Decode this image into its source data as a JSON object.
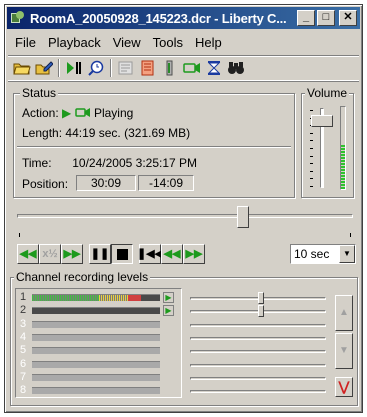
{
  "window": {
    "title": "RoomA_20050928_145223.dcr - Liberty C...",
    "minimize_label": "_",
    "maximize_label": "□",
    "close_label": "✕"
  },
  "menu": [
    "File",
    "Playback",
    "View",
    "Tools",
    "Help"
  ],
  "toolbar": {
    "icons": [
      "open-folder-icon",
      "open-edit-icon",
      "play-pause-icon",
      "search-clock-icon",
      "properties-icon",
      "notes-icon",
      "mute-icon",
      "record-icon",
      "timer-icon",
      "binoculars-icon"
    ]
  },
  "status": {
    "group_label": "Status",
    "action_label": "Action:",
    "action_value": "Playing",
    "length_label": "Length:",
    "length_value": "44:19 sec. (321.69 MB)",
    "time_label": "Time:",
    "time_value": "10/24/2005 3:25:17 PM",
    "position_label": "Position:",
    "position_elapsed": "30:09",
    "position_remaining": "-14:09"
  },
  "volume": {
    "group_label": "Volume",
    "level": 0.9,
    "meter_level": 0.55
  },
  "playback": {
    "position_fraction": 0.68,
    "skip_interval": "10 sec"
  },
  "channels": {
    "group_label": "Channel recording levels",
    "rows": [
      {
        "num": "1",
        "active": true,
        "level": 0.85,
        "gain": 0.5
      },
      {
        "num": "2",
        "active": true,
        "level": 0.0,
        "gain": 0.5
      },
      {
        "num": "3",
        "active": false,
        "level": 0,
        "gain": 0
      },
      {
        "num": "4",
        "active": false,
        "level": 0,
        "gain": 0
      },
      {
        "num": "5",
        "active": false,
        "level": 0,
        "gain": 0
      },
      {
        "num": "6",
        "active": false,
        "level": 0,
        "gain": 0
      },
      {
        "num": "7",
        "active": false,
        "level": 0,
        "gain": 0
      },
      {
        "num": "8",
        "active": false,
        "level": 0,
        "gain": 0
      }
    ]
  }
}
